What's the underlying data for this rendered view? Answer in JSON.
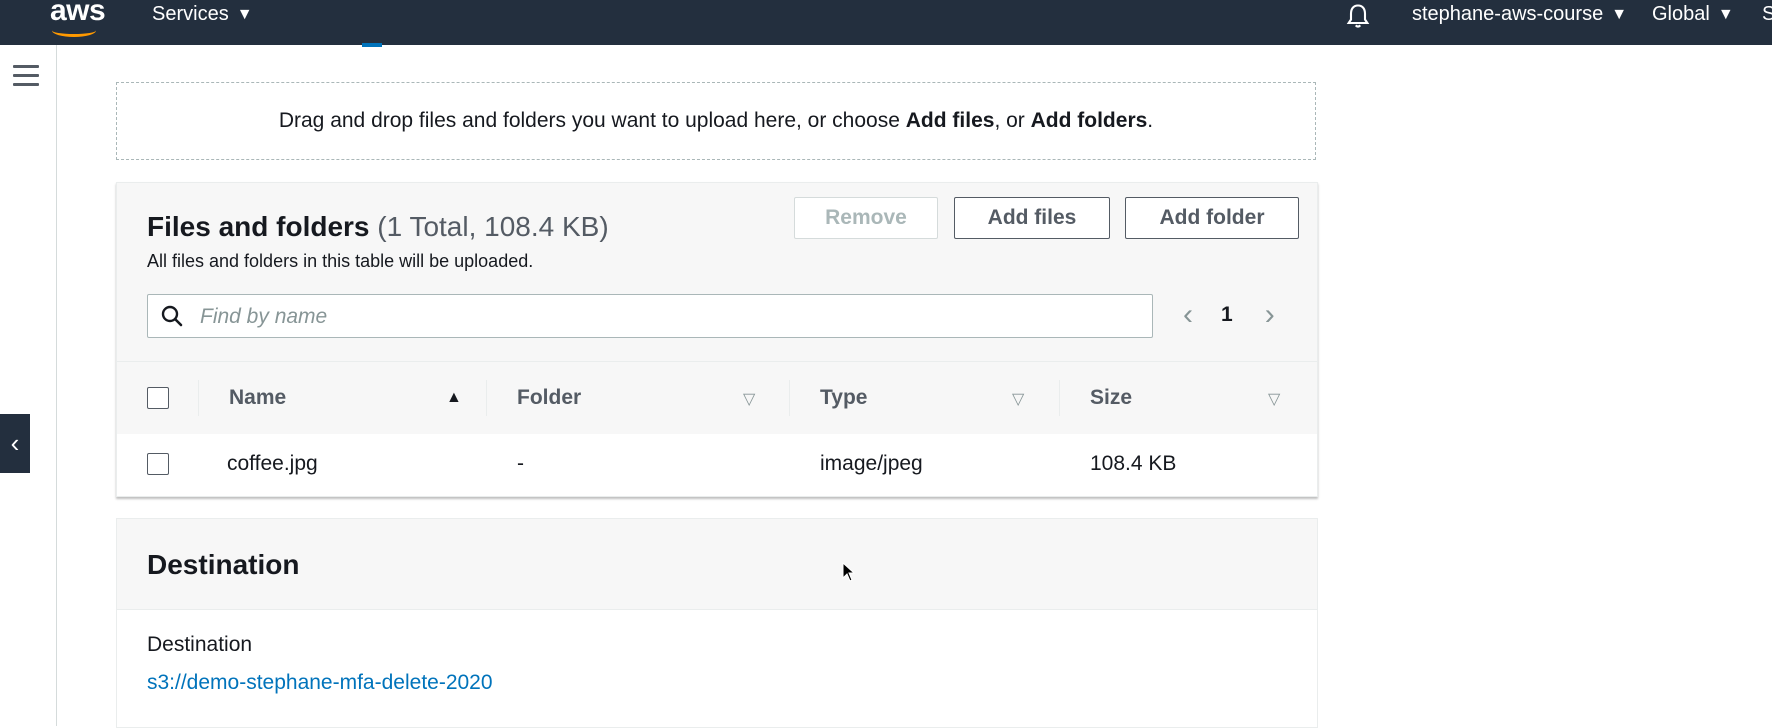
{
  "topnav": {
    "logo": "aws",
    "services_label": "Services",
    "account_label": "stephane-aws-course",
    "region_label": "Global",
    "support_label": "S",
    "icons": [
      "bell-icon",
      "caret-down-icon"
    ]
  },
  "sidebar": {
    "menu_icon": "hamburger-icon",
    "collapse_icon": "chevron-left-icon"
  },
  "dropzone": {
    "text_prefix": "Drag and drop files and folders you want to upload here, or choose ",
    "add_files": "Add files",
    "text_mid": ", or ",
    "add_folders": "Add folders",
    "text_suffix": "."
  },
  "files_panel": {
    "title": "Files and folders",
    "count": "(1 Total, 108.4 KB)",
    "subtitle": "All files and folders in this table will be uploaded.",
    "remove_label": "Remove",
    "add_files_label": "Add files",
    "add_folder_label": "Add folder",
    "search_placeholder": "Find by name",
    "page": "1",
    "columns": [
      "Name",
      "Folder",
      "Type",
      "Size"
    ],
    "rows": [
      {
        "name": "coffee.jpg",
        "folder": "-",
        "type": "image/jpeg",
        "size": "108.4 KB"
      }
    ]
  },
  "destination": {
    "title": "Destination",
    "label": "Destination",
    "link": "s3://demo-stephane-mfa-delete-2020"
  },
  "colors": {
    "nav_bg": "#232f3e",
    "accent_orange": "#ff9900",
    "link_blue": "#0073bb",
    "panel_bg": "#f7f7f7"
  }
}
